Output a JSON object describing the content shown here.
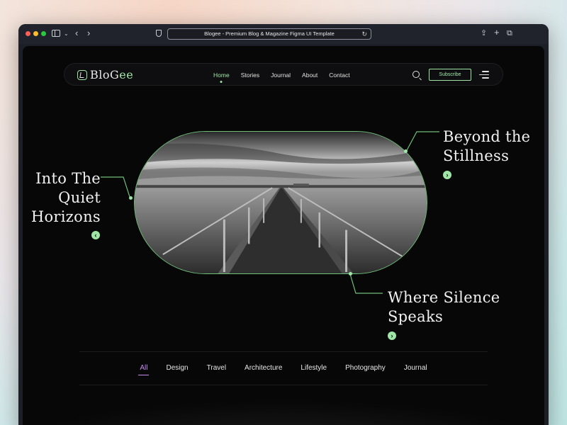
{
  "browser": {
    "url": "Blogee - Premium Blog & Magazine Figma UI Template"
  },
  "navbar": {
    "logo_main": "BloG",
    "logo_accent": "ee",
    "links": [
      "Home",
      "Stories",
      "Journal",
      "About",
      "Contact"
    ],
    "active_link": "Home",
    "subscribe_label": "Subscribe"
  },
  "hero": {
    "left_title": [
      "Into The",
      "Quiet",
      "Horizons"
    ],
    "top_right_title": [
      "Beyond the",
      "Stillness"
    ],
    "bottom_right_title": [
      "Where Silence",
      "Speaks"
    ],
    "arrow_left": "‹",
    "arrow_right": "›"
  },
  "categories": {
    "items": [
      "All",
      "Design",
      "Travel",
      "Architecture",
      "Lifestyle",
      "Photography",
      "Journal"
    ],
    "active": "All"
  },
  "colors": {
    "accent_green": "#9ee6a5",
    "accent_purple": "#c68cf0",
    "background": "#070707"
  }
}
